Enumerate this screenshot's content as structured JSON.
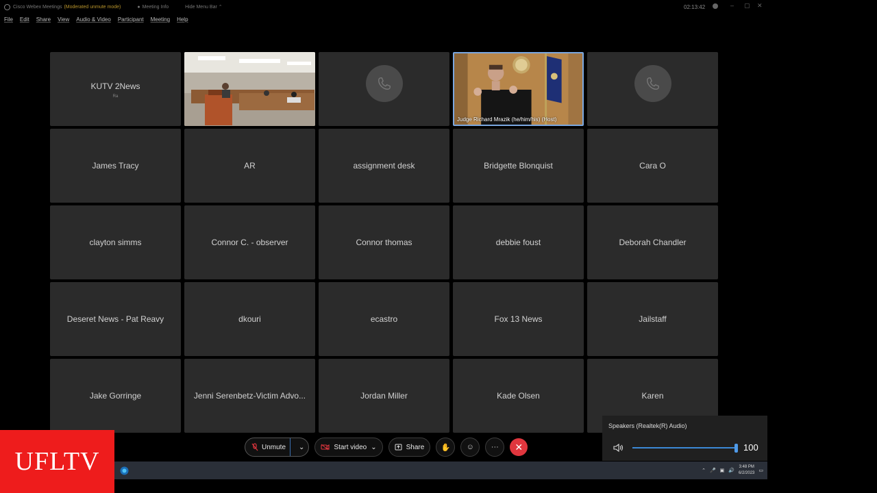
{
  "window": {
    "app_title": "Cisco Webex Meetings",
    "mode": "(Moderated unmute mode)",
    "meeting_info": "Meeting Info",
    "hide_menu_bar": "Hide Menu Bar",
    "clock": "02:13:42"
  },
  "menu": [
    "File",
    "Edit",
    "Share",
    "View",
    "Audio & Video",
    "Participant",
    "Meeting",
    "Help"
  ],
  "tiles": [
    {
      "name": "KUTV 2News",
      "sub": "Ra",
      "kind": "name"
    },
    {
      "name": "",
      "kind": "video-courtroom"
    },
    {
      "name": "",
      "kind": "phone"
    },
    {
      "name": "Judge Richard Mrazik (he/him/his) (Host)",
      "kind": "video-judge"
    },
    {
      "name": "",
      "kind": "phone"
    },
    {
      "name": "James Tracy",
      "kind": "name"
    },
    {
      "name": "AR",
      "kind": "name"
    },
    {
      "name": "assignment desk",
      "kind": "name"
    },
    {
      "name": "Bridgette Blonquist",
      "kind": "name"
    },
    {
      "name": "Cara O",
      "kind": "name"
    },
    {
      "name": "clayton simms",
      "kind": "name"
    },
    {
      "name": "Connor C. - observer",
      "kind": "name"
    },
    {
      "name": "Connor thomas",
      "kind": "name"
    },
    {
      "name": "debbie foust",
      "kind": "name"
    },
    {
      "name": "Deborah Chandler",
      "kind": "name"
    },
    {
      "name": "Deseret News - Pat Reavy",
      "kind": "name"
    },
    {
      "name": "dkouri",
      "kind": "name"
    },
    {
      "name": "ecastro",
      "kind": "name"
    },
    {
      "name": "Fox 13 News",
      "kind": "name"
    },
    {
      "name": "Jailstaff",
      "kind": "name"
    },
    {
      "name": "Jake Gorringe",
      "kind": "name"
    },
    {
      "name": "Jenni Serenbetz-Victim Advo...",
      "kind": "name"
    },
    {
      "name": "Jordan Miller",
      "kind": "name"
    },
    {
      "name": "Kade Olsen",
      "kind": "name"
    },
    {
      "name": "Karen",
      "kind": "name"
    }
  ],
  "controls": {
    "unmute": "Unmute",
    "start_video": "Start video",
    "share": "Share"
  },
  "speakers": {
    "label": "Speakers (Realtek(R) Audio)",
    "volume": "100",
    "level": 1.0
  },
  "taskbar": {
    "time": "3:48 PM",
    "date": "6/2/2023"
  },
  "logo": "UFLTV",
  "colors": {
    "accent": "#3c8ad8",
    "end_call": "#e0363e",
    "logo_bg": "#ee1c1c",
    "mode_text": "#b8942b"
  }
}
